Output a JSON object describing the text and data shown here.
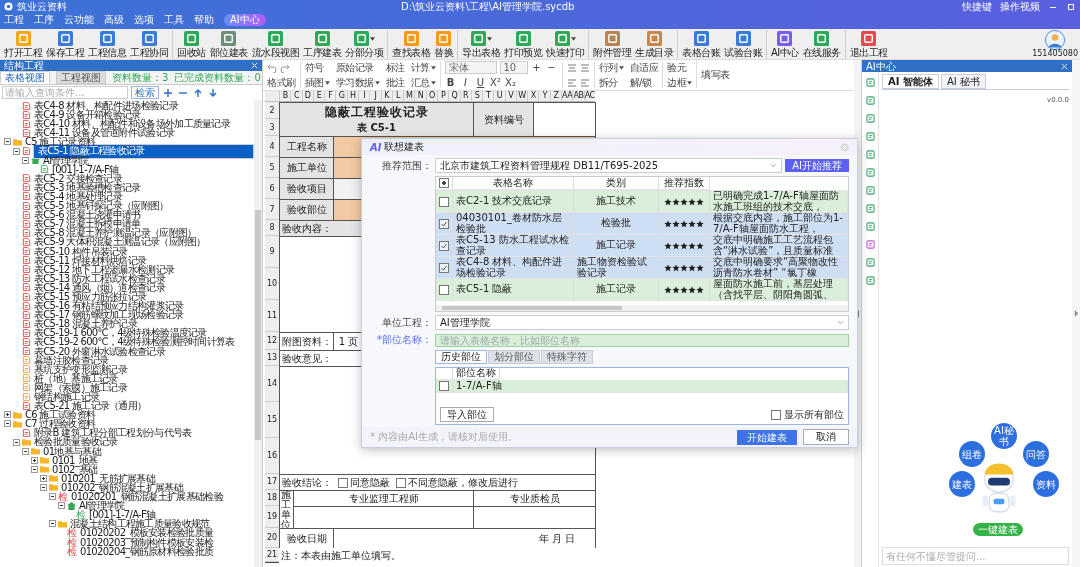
{
  "window": {
    "app_title": "筑业云资料",
    "path": "D:\\筑业云资料\\工程\\AI管理学院.sycdb",
    "shortcuts": "快捷键",
    "video_help": "操作视频"
  },
  "menu": [
    "工程",
    "工序",
    "云功能",
    "高级",
    "选项",
    "工具",
    "帮助"
  ],
  "menu_badge": "AI中心",
  "toolbar": [
    {
      "label": "打开工程",
      "color": "#f2a81d",
      "dropdown": false,
      "sep": false
    },
    {
      "label": "保存工程",
      "color": "#3a7bd5",
      "dropdown": false,
      "sep": false
    },
    {
      "label": "工程信息",
      "color": "#3a7bd5",
      "dropdown": false,
      "sep": false
    },
    {
      "label": "工程协同",
      "color": "#3a7bd5",
      "dropdown": false,
      "sep": true
    },
    {
      "label": "回收站",
      "color": "#2ea95a",
      "dropdown": false,
      "sep": false
    },
    {
      "label": "部位建表",
      "color": "#6d8f77",
      "dropdown": false,
      "sep": false
    },
    {
      "label": "流水段视图",
      "color": "#2ea95a",
      "dropdown": false,
      "sep": false
    },
    {
      "label": "工序建表",
      "color": "#2ea95a",
      "dropdown": false,
      "sep": false
    },
    {
      "label": "分部分项",
      "color": "#2ea95a",
      "dropdown": true,
      "sep": true
    },
    {
      "label": "查找表格",
      "color": "#f39a1e",
      "dropdown": false,
      "sep": false
    },
    {
      "label": "替换",
      "color": "#f39a1e",
      "dropdown": false,
      "sep": true
    },
    {
      "label": "导出表格",
      "color": "#2ea95a",
      "dropdown": true,
      "sep": false
    },
    {
      "label": "打印预览",
      "color": "#2ea95a",
      "dropdown": false,
      "sep": false
    },
    {
      "label": "快速打印",
      "color": "#2ea95a",
      "dropdown": true,
      "sep": true
    },
    {
      "label": "附件管理",
      "color": "#b98552",
      "dropdown": false,
      "sep": false
    },
    {
      "label": "生成目录",
      "color": "#c7864a",
      "dropdown": false,
      "sep": true
    },
    {
      "label": "表格台账",
      "color": "#3a7bd5",
      "dropdown": false,
      "sep": false
    },
    {
      "label": "试验台账",
      "color": "#3a7bd5",
      "dropdown": false,
      "sep": true
    },
    {
      "label": "AI中心",
      "color": "#7b5cf0",
      "dropdown": false,
      "sep": false
    },
    {
      "label": "在线服务",
      "color": "#2ea95a",
      "dropdown": false,
      "sep": true
    },
    {
      "label": "退出工程",
      "color": "#e5484d",
      "dropdown": false,
      "sep": false
    }
  ],
  "user": {
    "id": "151405080"
  },
  "left_panel": {
    "title": "结构工程",
    "tabs": [
      {
        "label": "表格视图",
        "selected": true
      },
      {
        "label": "工程视图",
        "selected": false
      }
    ],
    "count": "资料数量：3",
    "done": "已完成资料数量：0",
    "search_placeholder": "请输入查询条件...",
    "search_button": "检索",
    "tree": {
      "above": [
        {
          "label": "表C4-8 材料、构配件进场检验记录",
          "kind": "doc",
          "selected": false
        },
        {
          "label": "表C4-9 设备开箱检验记录",
          "kind": "doc",
          "selected": false
        },
        {
          "label": "表C4-10 材料、构配件和设备场外加工质量记录",
          "kind": "doc",
          "selected": false
        },
        {
          "label": "表C4-11 设备及管道附件试验记录",
          "kind": "doc",
          "selected": false
        }
      ],
      "nodes": [
        {
          "label": "C5 施工记录资料",
          "kind": "folder",
          "expanded": true,
          "selected": false,
          "children": [
            {
              "label": "表C5-1 隐蔽工程验收记录",
              "kind": "doc",
              "expanded": true,
              "selected": true,
              "children": [
                {
                  "label": "AI管理学院",
                  "kind": "house",
                  "expanded": true,
                  "selected": false,
                  "children": [
                    {
                      "label": "[001]-1-7/A-F轴",
                      "kind": "doc-green",
                      "selected": false
                    }
                  ]
                }
              ]
            },
            {
              "label": "表C5-2 交接检查记录",
              "kind": "doc",
              "selected": false
            },
            {
              "label": "表C5-3 地基验槽检查记录",
              "kind": "doc",
              "selected": false
            },
            {
              "label": "表C5-4 地基处理记录",
              "kind": "doc",
              "selected": false
            },
            {
              "label": "表C5-5 地基钎探记录（应附图）",
              "kind": "doc",
              "selected": false
            },
            {
              "label": "表C5-6 混凝土浇灌申请书",
              "kind": "doc",
              "selected": false
            },
            {
              "label": "表C5-7 混凝土拆模申请单",
              "kind": "doc",
              "selected": false
            },
            {
              "label": "表C5-8 混凝土养护测温记录（应附图）",
              "kind": "doc",
              "selected": false
            },
            {
              "label": "表C5-9 大体积混凝土测温记录（应附图）",
              "kind": "doc",
              "selected": false
            },
            {
              "label": "表C5-10 构件吊装记录",
              "kind": "doc",
              "selected": false
            },
            {
              "label": "表C5-11 焊接材料烘焙记录",
              "kind": "doc",
              "selected": false
            },
            {
              "label": "表C5-12 地下工程渗漏水检测记录",
              "kind": "doc",
              "selected": false
            },
            {
              "label": "表C5-13 防水工程试水检查记录",
              "kind": "doc",
              "selected": false
            },
            {
              "label": "表C5-14 通风（烟）道检查记录",
              "kind": "doc",
              "selected": false
            },
            {
              "label": "表C5-15 预应力筋张拉记录",
              "kind": "doc",
              "selected": false
            },
            {
              "label": "表C5-16 有粘结预应力结构灌浆记录",
              "kind": "doc",
              "selected": false
            },
            {
              "label": "表C5-17 钢筋螺纹加工现场检验记录",
              "kind": "doc",
              "selected": false
            },
            {
              "label": "表C5-18 混凝土养护记录",
              "kind": "doc",
              "selected": false
            },
            {
              "label": "表C5-19-1 600℃，4级特殊检验温度记录",
              "kind": "doc",
              "selected": false
            },
            {
              "label": "表C5-19-2 600℃，4级特殊检验测控时间计算表",
              "kind": "doc",
              "selected": false
            },
            {
              "label": "表C5-20 外窗淋水试验检查记录",
              "kind": "doc",
              "selected": false
            },
            {
              "label": "幕墙注胶检查记录",
              "kind": "doc-orange",
              "selected": false
            },
            {
              "label": "基坑支护变形监测记录",
              "kind": "doc-orange",
              "selected": false
            },
            {
              "label": "桩（地）基施工记录",
              "kind": "doc-orange",
              "selected": false
            },
            {
              "label": "网架（索膜）施工记录",
              "kind": "doc-orange",
              "selected": false
            },
            {
              "label": "钢结构施工记录",
              "kind": "doc-orange",
              "selected": false
            },
            {
              "label": "表C5-21 施工记录（通用）",
              "kind": "doc",
              "selected": false
            }
          ]
        },
        {
          "label": "C6 施工试验资料",
          "kind": "folder",
          "expanded": false,
          "selected": false
        },
        {
          "label": "C7 过程验收资料",
          "kind": "folder",
          "expanded": true,
          "selected": false,
          "children": [
            {
              "label": "附录B 建筑工程分部工程划分与代号表",
              "kind": "doc",
              "selected": false
            },
            {
              "label": "检验批质量验收记录",
              "kind": "folder",
              "expanded": true,
              "selected": false,
              "children": [
                {
                  "label": "01地基与基础",
                  "kind": "folder",
                  "expanded": true,
                  "selected": false,
                  "children": [
                    {
                      "label": "0101_地基",
                      "kind": "folder",
                      "expanded": false,
                      "selected": false
                    },
                    {
                      "label": "0102_基础",
                      "kind": "folder",
                      "expanded": true,
                      "selected": false,
                      "children": [
                        {
                          "label": "010201_无筋扩展基础",
                          "kind": "folder",
                          "expanded": false,
                          "selected": false
                        },
                        {
                          "label": "010202_钢筋混凝土扩展基础",
                          "kind": "folder",
                          "expanded": true,
                          "selected": false,
                          "children": [
                            {
                              "label": "01020201_钢筋混凝土扩展基础检验",
                              "kind": "check",
                              "mark": "检",
                              "expanded": true,
                              "selected": false,
                              "children": [
                                {
                                  "label": "AI管理学院",
                                  "kind": "house",
                                  "expanded": true,
                                  "selected": false,
                                  "children": [
                                    {
                                      "label": "[001]-1-7/A-F轴",
                                      "kind": "check-green",
                                      "mark": "检",
                                      "selected": false
                                    }
                                  ]
                                }
                              ]
                            },
                            {
                              "label": "混凝土结构工程施工质量验收规范",
                              "kind": "folder",
                              "expanded": true,
                              "selected": false,
                              "children": [
                                {
                                  "label": "01020202_模板安装检验批质量",
                                  "kind": "check",
                                  "mark": "检",
                                  "selected": false
                                },
                                {
                                  "label": "01020203_预制构件模板安装检",
                                  "kind": "check",
                                  "mark": "检",
                                  "selected": false
                                },
                                {
                                  "label": "01020204_钢筋原材料检验批质",
                                  "kind": "check",
                                  "mark": "检",
                                  "selected": false
                                }
                              ]
                            }
                          ]
                        }
                      ]
                    }
                  ]
                }
              ]
            }
          ]
        }
      ]
    }
  },
  "format_bar": {
    "format_painter": "格式刷",
    "groups": [
      [
        [
          {
            "label": "符号",
            "dropdown": false
          },
          {
            "label": "插图",
            "dropdown": true
          }
        ],
        [
          {
            "label": "原始记录",
            "dropdown": false
          },
          {
            "label": "学习数据",
            "dropdown": true
          }
        ],
        [
          {
            "label": "标注",
            "dropdown": false
          },
          {
            "label": "批注",
            "dropdown": false
          }
        ],
        [
          {
            "label": "计算",
            "dropdown": true
          },
          {
            "label": "汇总",
            "dropdown": true
          }
        ]
      ],
      [
        [
          {
            "label": "行列",
            "dropdown": true
          },
          {
            "label": "拆分",
            "dropdown": false
          }
        ],
        [
          {
            "label": "自适应",
            "dropdown": false
          },
          {
            "label": "解/锁",
            "dropdown": false
          }
        ]
      ],
      [
        [
          {
            "label": "验元",
            "dropdown": false
          },
          {
            "label": "边框",
            "dropdown": true
          }
        ]
      ],
      [
        [
          {
            "label": "填写表",
            "dropdown": false
          }
        ]
      ]
    ],
    "font": "宋体",
    "font_size": "10",
    "size_steps": [
      "+",
      "−"
    ],
    "styles": [
      "B",
      "I",
      "U",
      "X²",
      "X₂"
    ]
  },
  "sheet": {
    "columns": [
      "B",
      "C",
      "D",
      "E",
      "F",
      "G",
      "H",
      "I",
      "J",
      "K",
      "L",
      "M",
      "N",
      "O",
      "P",
      "Q",
      "R",
      "S",
      "T",
      "U",
      "V",
      "W",
      "X",
      "Y",
      "Z",
      "AA",
      "AB",
      "AC"
    ],
    "row_numbers": [
      "2",
      "3",
      "4",
      "5",
      "6",
      "7",
      "8",
      "9",
      "10",
      "11",
      "12",
      "13",
      "14",
      "15",
      "16",
      "17",
      "18",
      "19",
      "20",
      "21"
    ],
    "title": "隐蔽工程验收记录",
    "form_no": "表 C5-1",
    "doc_no_label": "资料编号",
    "fields": [
      {
        "label": "工程名称",
        "required": true
      },
      {
        "label": "施工单位",
        "required": true
      },
      {
        "label": "验收项目",
        "required": false
      },
      {
        "label": "验收部位",
        "required": true
      }
    ],
    "content_label": "验收内容：",
    "attach_label": "附图资料：",
    "attach_count": "1",
    "attach_unit": "页",
    "opinion_label": "验收意见：",
    "conclusion_label": "验收结论：",
    "options": [
      {
        "label": "同意隐蔽",
        "checked": false
      },
      {
        "label": "不同意隐蔽，修改后进行",
        "checked": false
      }
    ],
    "unit_label": "施工单位",
    "sign_cols": [
      "专业监理工程师",
      "专业质检员"
    ],
    "date_label": "验收日期",
    "date_value": "年    月    日",
    "note": "注：本表由施工单位填写。"
  },
  "dialog": {
    "title_badge": "AI",
    "title": "联想建表",
    "scope_label": "推荐范围：",
    "scope_value": "北京市建筑工程资料管理规程 DB11/T695-2025",
    "recommend_button": "AI开始推荐",
    "select_all_partial": true,
    "columns": [
      "表格名称",
      "类别",
      "推荐指数"
    ],
    "rows": [
      {
        "checked": false,
        "name": "表C2-1 技术交底记录",
        "category": "施工技术",
        "stars": 5,
        "reason": "已明确完成1-7/A-F轴屋面防水施工班组的技术交底，"
      },
      {
        "checked": true,
        "name": "04030101_卷材防水层检验批",
        "category": "检验批",
        "stars": 5,
        "reason": "根据交底内容，施工部位为1-7/A-F轴屋面防水工程，"
      },
      {
        "checked": true,
        "name": "表C5-13 防水工程试水检查记录",
        "category": "施工记录",
        "stars": 5,
        "reason": "交底中明确施工工艺流程包含“淋水试验”，且质量标准"
      },
      {
        "checked": true,
        "name": "表C4-8 材料、构配件进场检验记录",
        "category": "施工物资检验试验记录",
        "stars": 5,
        "reason": "交底中明确要求“高聚物改性沥青防水卷材” “氯丁橡"
      },
      {
        "checked": false,
        "name": "表C5-1 隐蔽",
        "category": "施工记录",
        "stars": 5,
        "reason": "屋面防水施工前，基层处理（含找平层、阴阳角圆弧、"
      }
    ],
    "unit_label": "单位工程：",
    "unit_value": "AI管理学院",
    "part_label": "*部位名称：",
    "part_placeholder": "请输入表格名称，比如部位名称",
    "part_tabs": [
      {
        "label": "历史部位",
        "selected": true
      },
      {
        "label": "划分部位",
        "selected": false
      },
      {
        "label": "特殊字符",
        "selected": false
      }
    ],
    "part_column": "部位名称",
    "parts": [
      {
        "name": "1-7/A-F轴",
        "checked": false
      }
    ],
    "import_button": "导入部位",
    "show_all": {
      "label": "显示所有部位",
      "checked": false
    },
    "note": "* 内容由AI生成，请核对后使用。",
    "ok": "开始建表",
    "cancel": "取消"
  },
  "right_panel": {
    "title": "AI中心",
    "tabs": [
      {
        "label": "AI 智能体",
        "selected": true
      },
      {
        "label": "AI 秘书",
        "selected": false
      }
    ],
    "version": "v0.0.0",
    "bubbles": [
      "AI秘书",
      "组卷",
      "问答",
      "建表",
      "资料"
    ],
    "quick_button": "一键建表",
    "input_placeholder": "有任何不懂尽管提问..."
  }
}
